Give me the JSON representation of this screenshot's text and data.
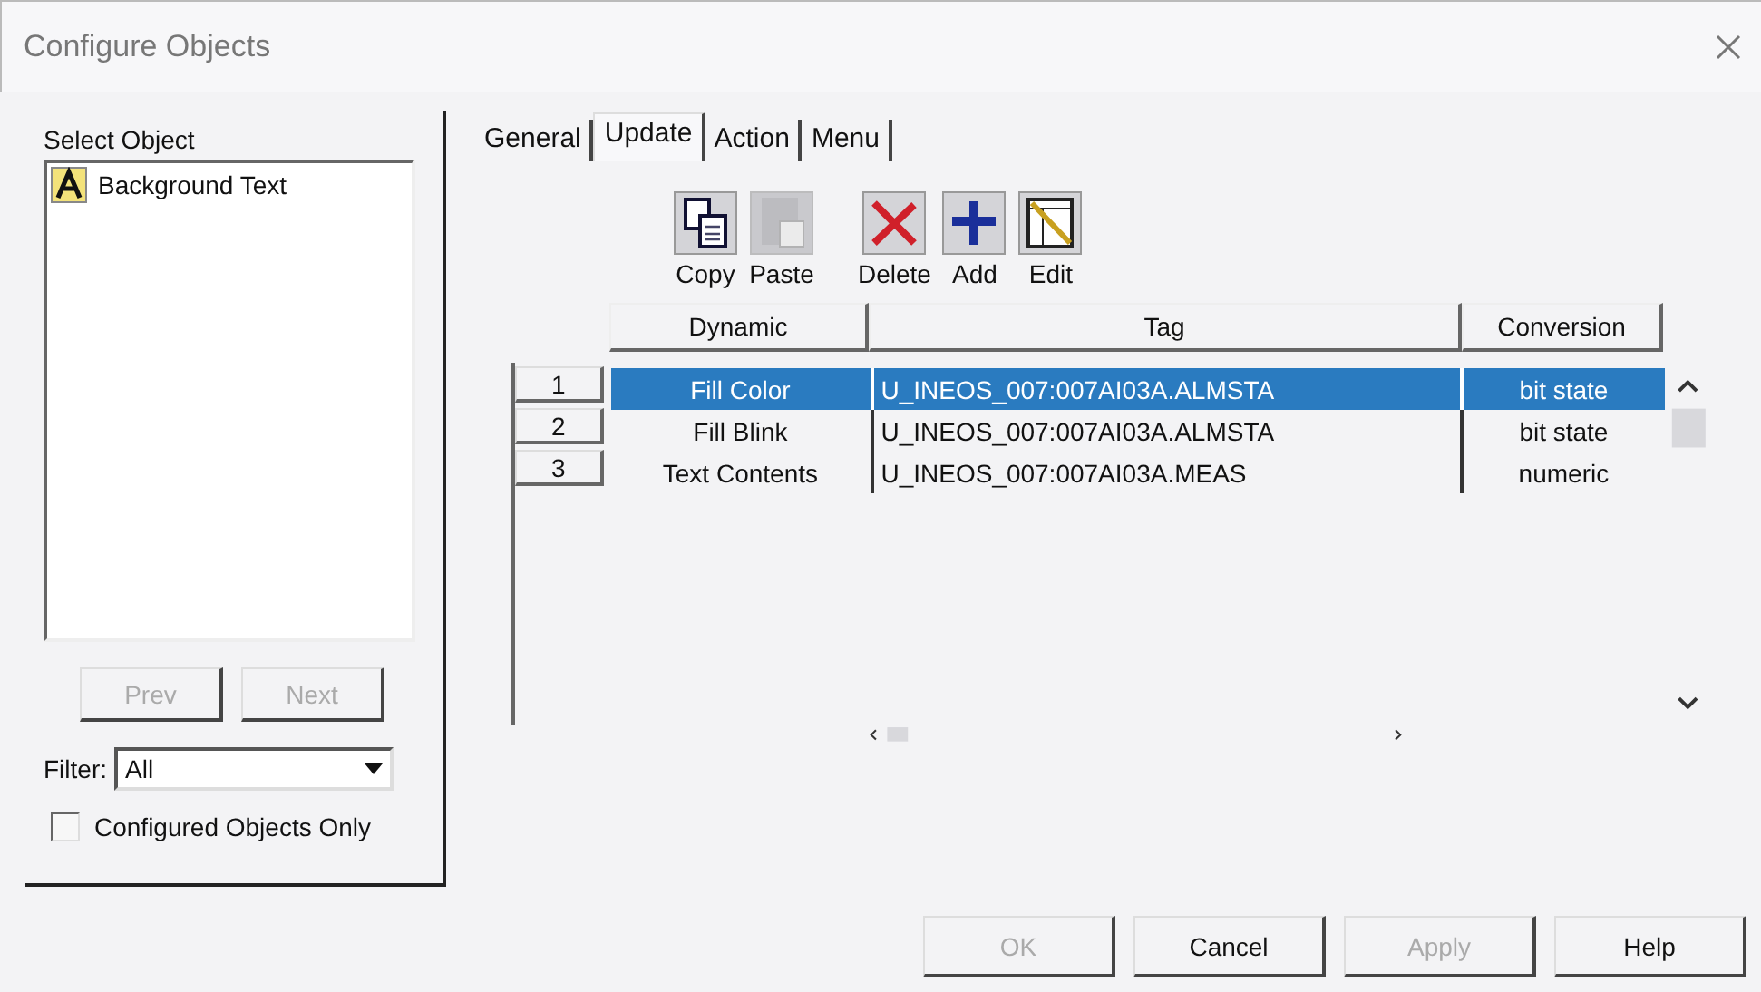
{
  "window": {
    "title": "Configure Objects"
  },
  "select_object": {
    "label": "Select Object",
    "items": [
      {
        "label": "Background Text"
      }
    ]
  },
  "nav_buttons": [
    {
      "label": "Prev",
      "disabled": true
    },
    {
      "label": "Next",
      "disabled": true
    }
  ],
  "filter": {
    "label": "Filter:",
    "value": "All"
  },
  "configured_only": {
    "label": "Configured Objects Only",
    "checked": false
  },
  "tabs": [
    {
      "label": "General",
      "selected": false
    },
    {
      "label": "Update",
      "selected": true
    },
    {
      "label": "Action",
      "selected": false
    },
    {
      "label": "Menu",
      "selected": false
    }
  ],
  "toolbar": [
    {
      "label": "Copy",
      "kind": "copy",
      "disabled": false
    },
    {
      "label": "Paste",
      "kind": "paste",
      "disabled": true
    },
    {
      "label": "Delete",
      "kind": "delete",
      "disabled": false
    },
    {
      "label": "Add",
      "kind": "add",
      "disabled": false
    },
    {
      "label": "Edit",
      "kind": "edit",
      "disabled": false
    }
  ],
  "table": {
    "columns": [
      "Dynamic",
      "Tag",
      "Conversion"
    ],
    "rows": [
      {
        "number": "1",
        "dynamic": "Fill Color",
        "tag": "U_INEOS_007:007AI03A.ALMSTA",
        "conversion": "bit state",
        "selected": true
      },
      {
        "number": "2",
        "dynamic": "Fill Blink",
        "tag": "U_INEOS_007:007AI03A.ALMSTA",
        "conversion": "bit state",
        "selected": false
      },
      {
        "number": "3",
        "dynamic": "Text Contents",
        "tag": "U_INEOS_007:007AI03A.MEAS",
        "conversion": "numeric",
        "selected": false
      }
    ]
  },
  "buttons": [
    {
      "label": "OK",
      "disabled": true
    },
    {
      "label": "Cancel",
      "disabled": false
    },
    {
      "label": "Apply",
      "disabled": true
    },
    {
      "label": "Help",
      "disabled": false
    }
  ]
}
